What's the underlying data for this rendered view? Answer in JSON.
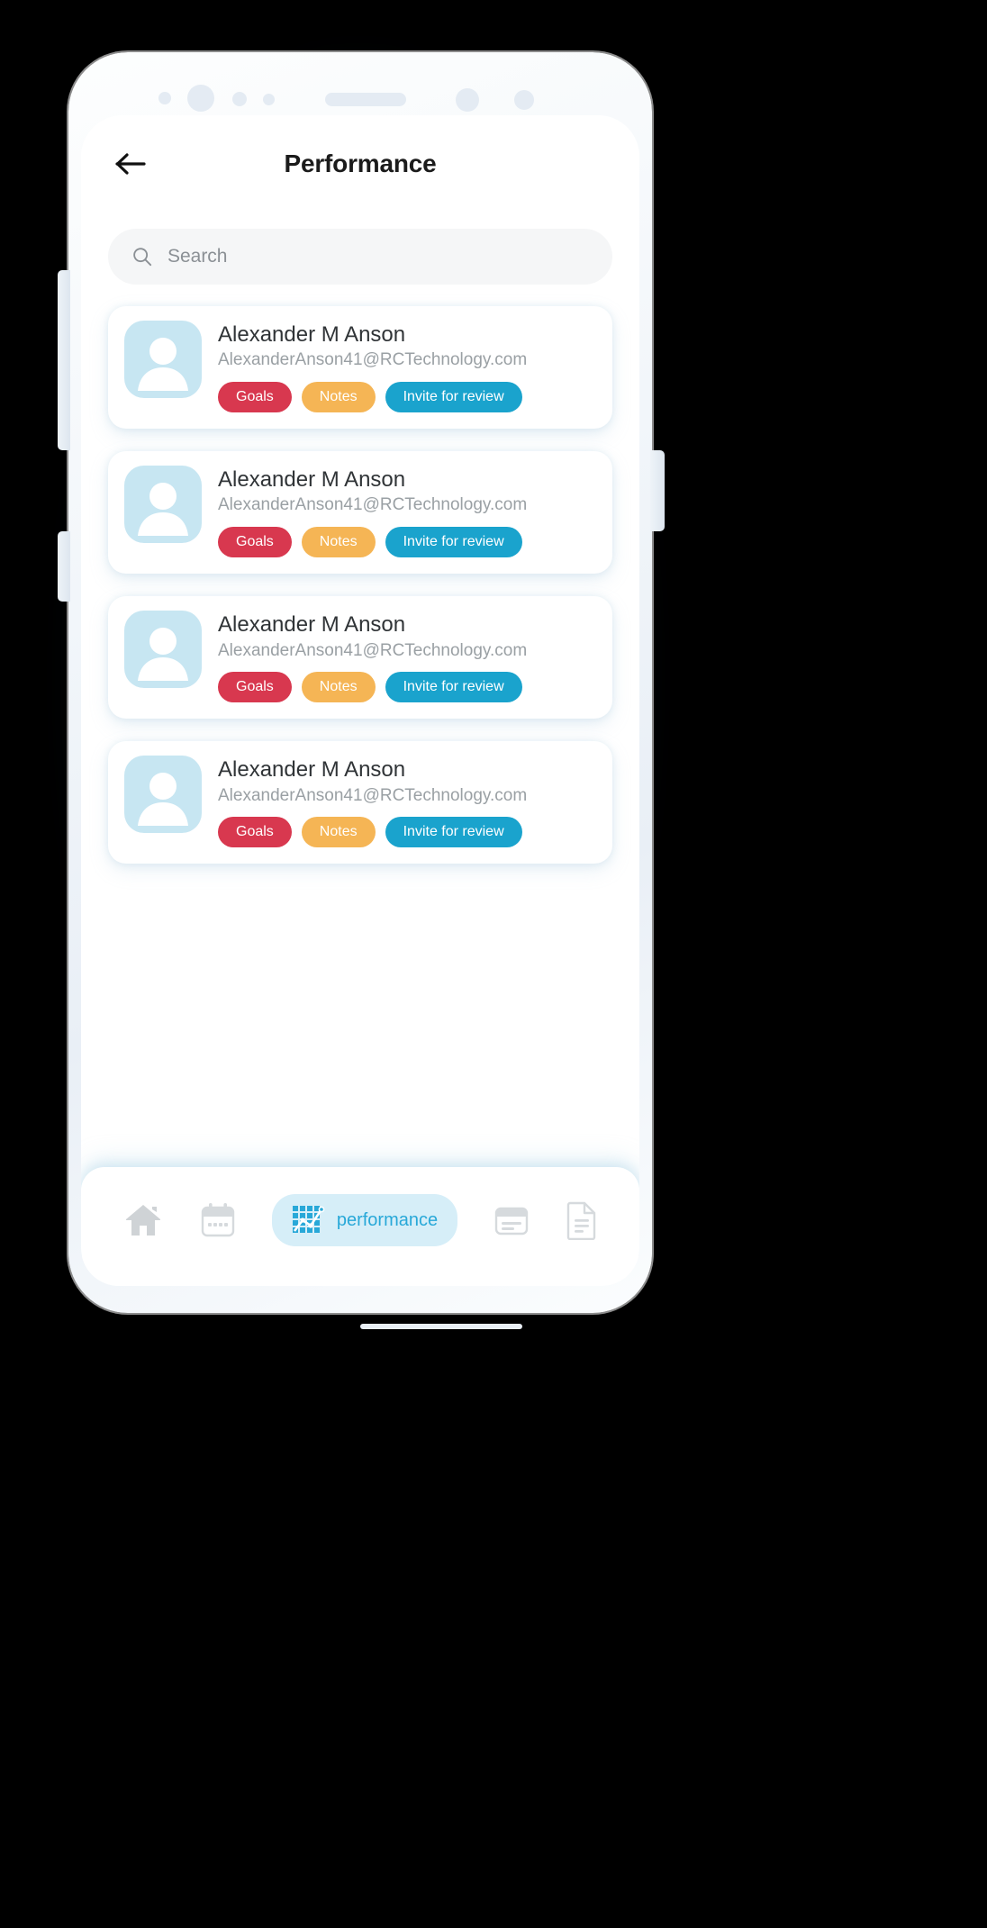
{
  "device": {
    "frame_name": "smartphone-mockup",
    "sensors": [
      "camera-dot",
      "camera-lens",
      "sensor-dot",
      "sensor-dot-small",
      "earpiece-speaker",
      "sensor-dot",
      "sensor-dot"
    ]
  },
  "header": {
    "back_icon": "arrow-left-icon",
    "title": "Performance"
  },
  "search": {
    "icon": "search-icon",
    "placeholder": "Search",
    "value": ""
  },
  "colors": {
    "accent": "#28a8d8",
    "goals": "#d8384f",
    "notes": "#f5b košt",
    "notes_hex": "#f5b555",
    "invite": "#1aa3cd",
    "avatar_bg": "#c7e6f2",
    "pill_bg": "#d6eef8",
    "title": "#1b1b1b",
    "email": "#9aa0a4"
  },
  "list": {
    "cards": [
      {
        "avatar_icon": "user-avatar-icon",
        "name": "Alexander M Anson",
        "email": "AlexanderAnson41@RCTechnology.com",
        "chips": [
          {
            "label": "Goals",
            "color": "#d8384f"
          },
          {
            "label": "Notes",
            "color": "#f5b555"
          },
          {
            "label": "Invite for review",
            "color": "#1aa3cd"
          }
        ]
      },
      {
        "avatar_icon": "user-avatar-icon",
        "name": "Alexander M Anson",
        "email": "AlexanderAnson41@RCTechnology.com",
        "chips": [
          {
            "label": "Goals",
            "color": "#d8384f"
          },
          {
            "label": "Notes",
            "color": "#f5b555"
          },
          {
            "label": "Invite for review",
            "color": "#1aa3cd"
          }
        ]
      },
      {
        "avatar_icon": "user-avatar-icon",
        "name": "Alexander M Anson",
        "email": "AlexanderAnson41@RCTechnology.com",
        "chips": [
          {
            "label": "Goals",
            "color": "#d8384f"
          },
          {
            "label": "Notes",
            "color": "#f5b555"
          },
          {
            "label": "Invite for review",
            "color": "#1aa3cd"
          }
        ]
      },
      {
        "avatar_icon": "user-avatar-icon",
        "name": "Alexander M Anson",
        "email": "AlexanderAnson41@RCTechnology.com",
        "chips": [
          {
            "label": "Goals",
            "color": "#d8384f"
          },
          {
            "label": "Notes",
            "color": "#f5b555"
          },
          {
            "label": "Invite for review",
            "color": "#1aa3cd"
          }
        ]
      }
    ]
  },
  "tabbar": {
    "items": [
      {
        "icon": "home-icon",
        "label": "",
        "active": false
      },
      {
        "icon": "calendar-icon",
        "label": "",
        "active": false
      },
      {
        "icon": "performance-chart-icon",
        "label": "performance",
        "active": true
      },
      {
        "icon": "calendar-alt-icon",
        "label": "",
        "active": false
      },
      {
        "icon": "document-icon",
        "label": "",
        "active": false
      }
    ]
  }
}
